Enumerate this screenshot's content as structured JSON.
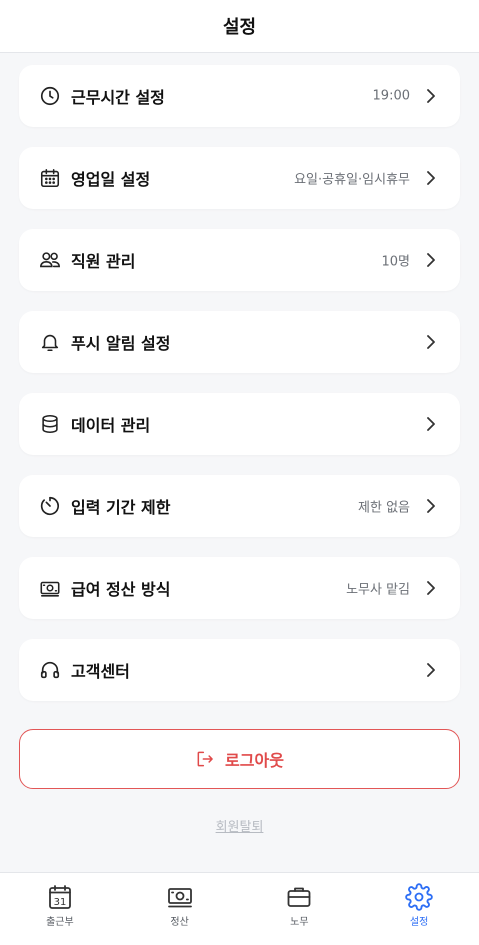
{
  "header": {
    "title": "설정"
  },
  "settings": [
    {
      "label": "근무시간 설정",
      "value": "19:00",
      "icon": "clock-icon"
    },
    {
      "label": "영업일 설정",
      "value": "요일·공휴일·임시휴무",
      "icon": "calendar-icon"
    },
    {
      "label": "직원 관리",
      "value": "10명",
      "icon": "users-icon"
    },
    {
      "label": "푸시 알림 설정",
      "value": "",
      "icon": "bell-icon"
    },
    {
      "label": "데이터 관리",
      "value": "",
      "icon": "database-icon"
    },
    {
      "label": "입력 기간 제한",
      "value": "제한 없음",
      "icon": "timer-icon"
    },
    {
      "label": "급여 정산 방식",
      "value": "노무사 맡김",
      "icon": "money-icon"
    },
    {
      "label": "고객센터",
      "value": "",
      "icon": "headset-icon"
    }
  ],
  "logout": {
    "label": "로그아웃",
    "color": "#e04a4a"
  },
  "withdraw": {
    "label": "회원탈퇴"
  },
  "tabbar": {
    "items": [
      {
        "label": "출근부",
        "icon": "calendar-31-icon",
        "calendar_day": "31",
        "active": false
      },
      {
        "label": "정산",
        "icon": "money-icon",
        "active": false
      },
      {
        "label": "노무",
        "icon": "briefcase-icon",
        "active": false
      },
      {
        "label": "설정",
        "icon": "gear-icon",
        "active": true
      }
    ],
    "active_color": "#2d6ef5"
  }
}
